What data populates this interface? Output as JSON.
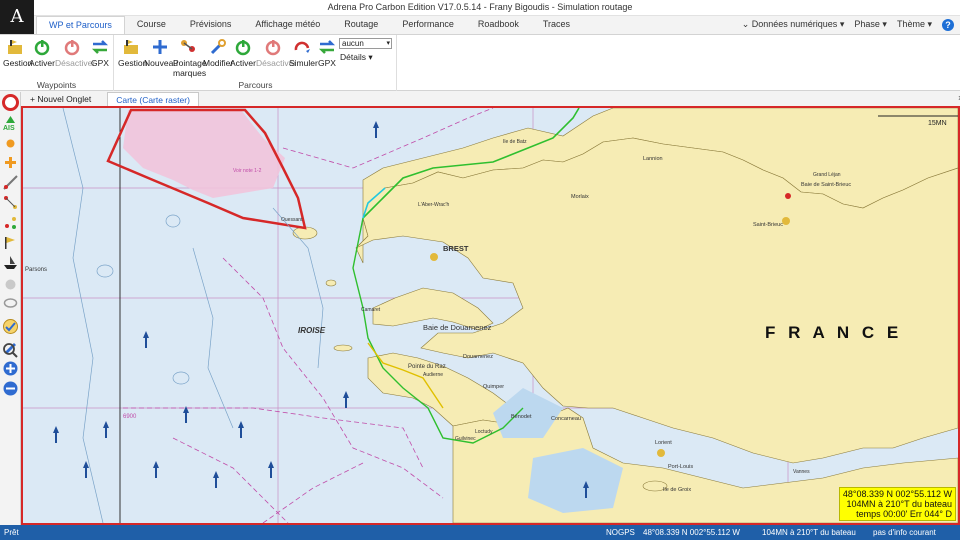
{
  "window": {
    "logo": "A",
    "title": "Adrena Pro Carbon Edition V17.0.5.14 - Frany Bigoudis - Simulation routage"
  },
  "ribbon_tabs": [
    "WP et Parcours",
    "Course",
    "Prévisions",
    "Affichage météo",
    "Routage",
    "Performance",
    "Roadbook",
    "Traces"
  ],
  "ribbon_right": {
    "donnees": "Données numériques",
    "phase": "Phase",
    "theme": "Thème",
    "help": "?"
  },
  "waypoints_group": {
    "caption": "Waypoints",
    "buttons": [
      "Gestion",
      "Activer",
      "Désactiver",
      "GPX"
    ]
  },
  "parcours_group": {
    "caption": "Parcours",
    "buttons": [
      "Gestion",
      "Nouveau",
      "Pointage marques",
      "Modifier",
      "Activer",
      "Désactiver",
      "Simuler",
      "GPX"
    ],
    "select_value": "aucun",
    "details": "Détails"
  },
  "doc_tabs": {
    "new_tab": "Nouvel Onglet",
    "chart_tab": "Carte (Carte raster)",
    "close": "×"
  },
  "map": {
    "country_label": "F R A N C E",
    "scale_label": "15MN",
    "place_labels": [
      "BREST",
      "IROISE",
      "Baie de Douarnenez",
      "Douarnenez",
      "Pointe du Raz",
      "Quimper",
      "Lannion",
      "Morlaix",
      "Saint-Brieuc",
      "Baie de Saint-Brieuc",
      "Lorient",
      "Port-Louis",
      "Ile de Groix",
      "Concarneau",
      "Bénodet",
      "Loctudy",
      "Guilvinec",
      "Audierne",
      "Ile de Batz",
      "L'Aber-Wrac'h",
      "Ouessant",
      "Camaret",
      "Parsons",
      "Grand Léjan",
      "Vannes"
    ],
    "zone_note": "Voir note 1-2",
    "depth_label": "6900"
  },
  "coord_box": {
    "line1": "48°08.339 N  002°55.112 W",
    "line2": "104MN à 210°T du bateau",
    "line3": "temps 00:00' Err 044° D"
  },
  "status_bar": {
    "ready": "Prêt",
    "nogps": "NOGPS",
    "position": "48°08.339 N  002°55.112 W",
    "distance": "104MN à 210°T du bateau",
    "info": "pas d'info courant"
  },
  "colors": {
    "sea": "#dbe9f5",
    "land": "#f6ecb4",
    "route_green": "#2fbf2f",
    "route_cyan": "#22c8e0",
    "zone": "#d62828",
    "status_bar": "#1f5fa8",
    "highlight": "#ffff00"
  }
}
